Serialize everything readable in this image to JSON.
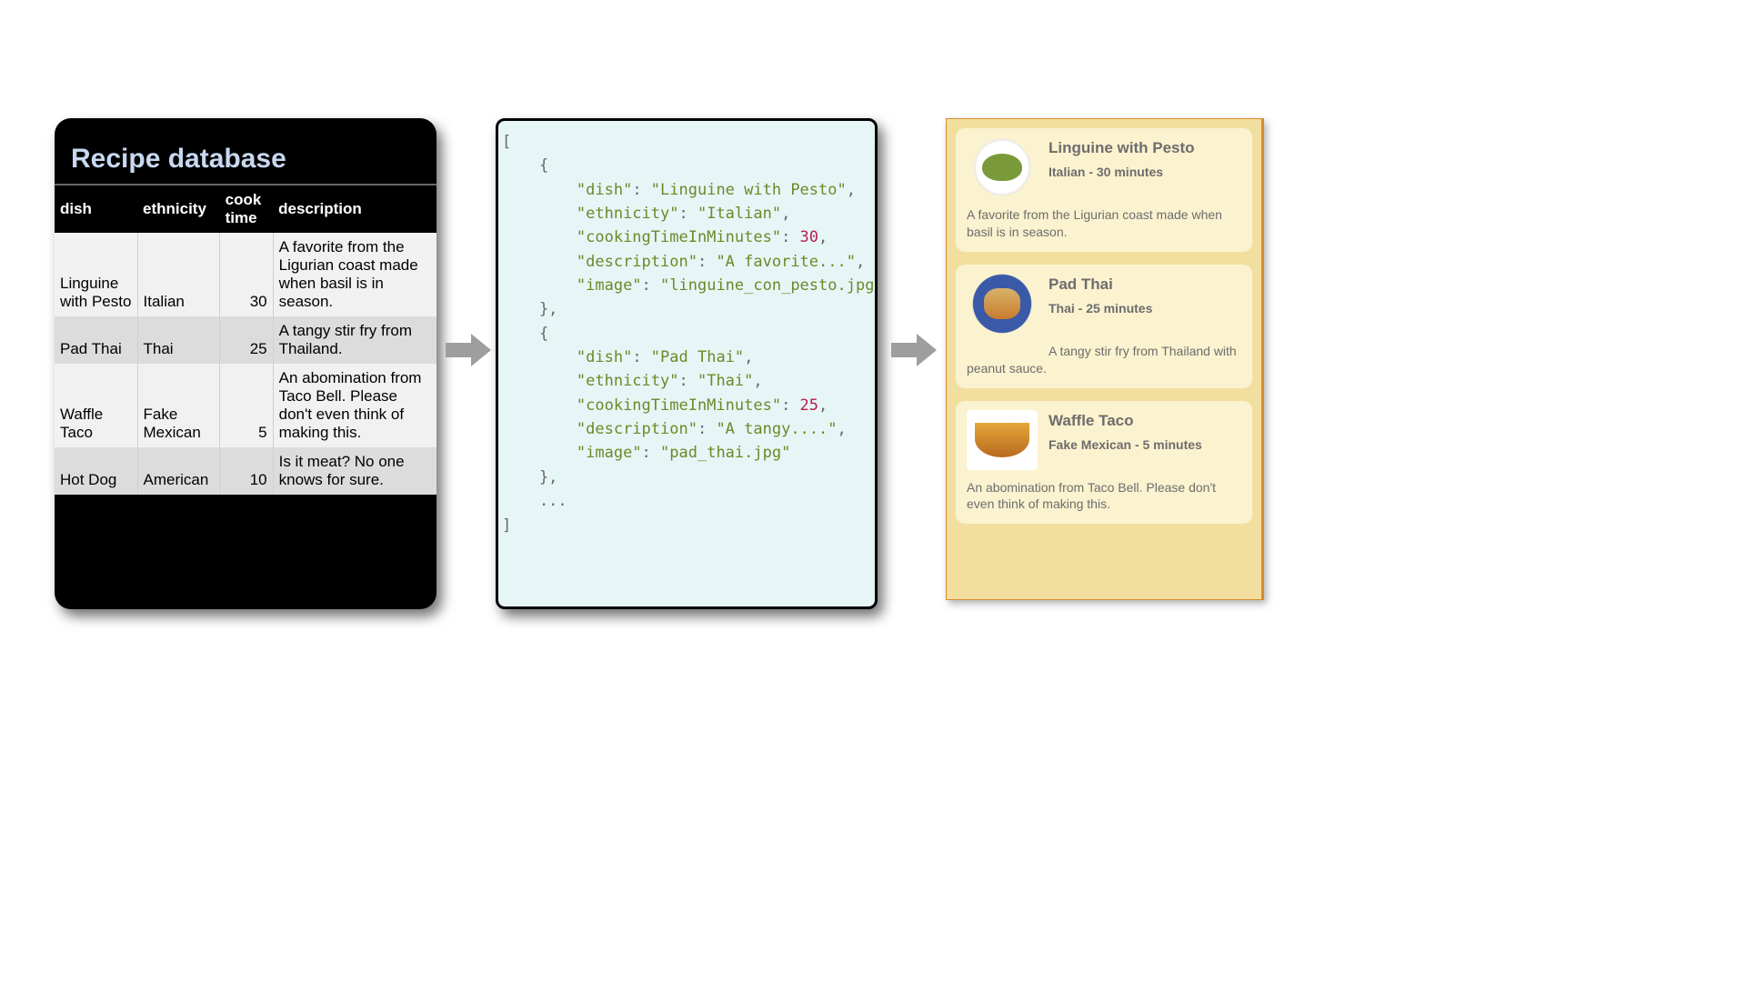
{
  "db": {
    "title": "Recipe database",
    "headers": [
      "dish",
      "ethnicity",
      "cook time",
      "description"
    ],
    "rows": [
      {
        "dish": "Linguine with Pesto",
        "ethnicity": "Italian",
        "cook_time": 30,
        "description": "A favorite from the Ligurian coast made when basil is in season."
      },
      {
        "dish": "Pad Thai",
        "ethnicity": "Thai",
        "cook_time": 25,
        "description": "A tangy stir fry from Thailand."
      },
      {
        "dish": "Waffle Taco",
        "ethnicity": "Fake Mexican",
        "cook_time": 5,
        "description": "An abomination from Taco Bell. Please don't even think of making this."
      },
      {
        "dish": "Hot Dog",
        "ethnicity": "American",
        "cook_time": 10,
        "description": "Is it meat? No one knows for sure."
      }
    ]
  },
  "json_panel": {
    "lines": [
      [
        {
          "t": "[",
          "c": "p"
        }
      ],
      [
        {
          "t": "    {",
          "c": "p"
        }
      ],
      [
        {
          "t": "        ",
          "c": "p"
        },
        {
          "t": "\"dish\"",
          "c": "k"
        },
        {
          "t": ": ",
          "c": "p"
        },
        {
          "t": "\"Linguine with Pesto\"",
          "c": "s"
        },
        {
          "t": ",",
          "c": "p"
        }
      ],
      [
        {
          "t": "        ",
          "c": "p"
        },
        {
          "t": "\"ethnicity\"",
          "c": "k"
        },
        {
          "t": ": ",
          "c": "p"
        },
        {
          "t": "\"Italian\"",
          "c": "s"
        },
        {
          "t": ",",
          "c": "p"
        }
      ],
      [
        {
          "t": "        ",
          "c": "p"
        },
        {
          "t": "\"cookingTimeInMinutes\"",
          "c": "k"
        },
        {
          "t": ": ",
          "c": "p"
        },
        {
          "t": "30",
          "c": "n"
        },
        {
          "t": ",",
          "c": "p"
        }
      ],
      [
        {
          "t": "        ",
          "c": "p"
        },
        {
          "t": "\"description\"",
          "c": "k"
        },
        {
          "t": ": ",
          "c": "p"
        },
        {
          "t": "\"A favorite...\"",
          "c": "s"
        },
        {
          "t": ",",
          "c": "p"
        }
      ],
      [
        {
          "t": "        ",
          "c": "p"
        },
        {
          "t": "\"image\"",
          "c": "k"
        },
        {
          "t": ": ",
          "c": "p"
        },
        {
          "t": "\"linguine_con_pesto.jpg\"",
          "c": "s"
        }
      ],
      [
        {
          "t": "    },",
          "c": "p"
        }
      ],
      [
        {
          "t": "    {",
          "c": "p"
        }
      ],
      [
        {
          "t": "        ",
          "c": "p"
        },
        {
          "t": "\"dish\"",
          "c": "k"
        },
        {
          "t": ": ",
          "c": "p"
        },
        {
          "t": "\"Pad Thai\"",
          "c": "s"
        },
        {
          "t": ",",
          "c": "p"
        }
      ],
      [
        {
          "t": "        ",
          "c": "p"
        },
        {
          "t": "\"ethnicity\"",
          "c": "k"
        },
        {
          "t": ": ",
          "c": "p"
        },
        {
          "t": "\"Thai\"",
          "c": "s"
        },
        {
          "t": ",",
          "c": "p"
        }
      ],
      [
        {
          "t": "        ",
          "c": "p"
        },
        {
          "t": "\"cookingTimeInMinutes\"",
          "c": "k"
        },
        {
          "t": ": ",
          "c": "p"
        },
        {
          "t": "25",
          "c": "n"
        },
        {
          "t": ",",
          "c": "p"
        }
      ],
      [
        {
          "t": "        ",
          "c": "p"
        },
        {
          "t": "\"description\"",
          "c": "k"
        },
        {
          "t": ": ",
          "c": "p"
        },
        {
          "t": "\"A tangy....\"",
          "c": "s"
        },
        {
          "t": ",",
          "c": "p"
        }
      ],
      [
        {
          "t": "        ",
          "c": "p"
        },
        {
          "t": "\"image\"",
          "c": "k"
        },
        {
          "t": ": ",
          "c": "p"
        },
        {
          "t": "\"pad_thai.jpg\"",
          "c": "s"
        }
      ],
      [
        {
          "t": "    },",
          "c": "p"
        }
      ],
      [
        {
          "t": "    ...",
          "c": "p"
        }
      ],
      [
        {
          "t": "]",
          "c": "p"
        }
      ]
    ]
  },
  "cards": [
    {
      "title": "Linguine with Pesto",
      "sub": "Italian - 30 minutes",
      "desc": "A favorite from the Ligurian coast made when basil is in season.",
      "thumb": "plate-white"
    },
    {
      "title": "Pad Thai",
      "sub": "Thai - 25 minutes",
      "desc": "A tangy stir fry from Thailand with peanut sauce.",
      "thumb": "plate-blue"
    },
    {
      "title": "Waffle Taco",
      "sub": "Fake Mexican - 5 minutes",
      "desc": "An abomination from Taco Bell. Please don't even think of making this.",
      "thumb": "waffle"
    }
  ]
}
